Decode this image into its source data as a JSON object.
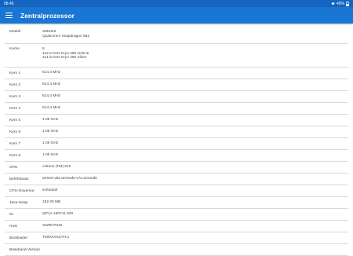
{
  "status_bar": {
    "time": "08:45",
    "battery": "40%"
  },
  "toolbar": {
    "title": "Zentralprozessor"
  },
  "rows": [
    {
      "label": "Modell",
      "lines": [
        "SM6115",
        "Qualcomm Snapdragon 662"
      ]
    },
    {
      "label": "Kerne",
      "lines": [
        "8",
        "4x2.0 GHz Kryo 260 Gold &",
        "4x1.8 GHz Kryo 260 Silver"
      ]
    },
    {
      "label": "Kern 1",
      "lines": [
        "614.4 MHz"
      ]
    },
    {
      "label": "Kern 2",
      "lines": [
        "614.4 MHz"
      ]
    },
    {
      "label": "Kern 3",
      "lines": [
        "614.4 MHz"
      ]
    },
    {
      "label": "Kern 4",
      "lines": [
        "614.4 MHz"
      ]
    },
    {
      "label": "Kern 5",
      "lines": [
        "1.06 GHz"
      ]
    },
    {
      "label": "Kern 6",
      "lines": [
        "1.06 GHz"
      ]
    },
    {
      "label": "Kern 7",
      "lines": [
        "1.06 GHz"
      ]
    },
    {
      "label": "Kern 8",
      "lines": [
        "1.06 GHz"
      ]
    },
    {
      "label": "GPU",
      "lines": [
        "Adreno (TM) 610"
      ]
    },
    {
      "label": "Befehlssatz",
      "lines": [
        "arm64-v8a armeabi-v7a armeabi"
      ]
    },
    {
      "label": "CPU-Governor",
      "lines": [
        "schedutil"
      ]
    },
    {
      "label": "Java-Heap",
      "lines": [
        "192.00 MB"
      ]
    },
    {
      "label": "ID",
      "lines": [
        "QP1A.190711.020"
      ]
    },
    {
      "label": "Host",
      "lines": [
        "SWDH7015"
      ]
    },
    {
      "label": "Bootloader",
      "lines": [
        "T500XXS2ATL1"
      ]
    },
    {
      "label": "Baseband Version",
      "lines": []
    }
  ]
}
